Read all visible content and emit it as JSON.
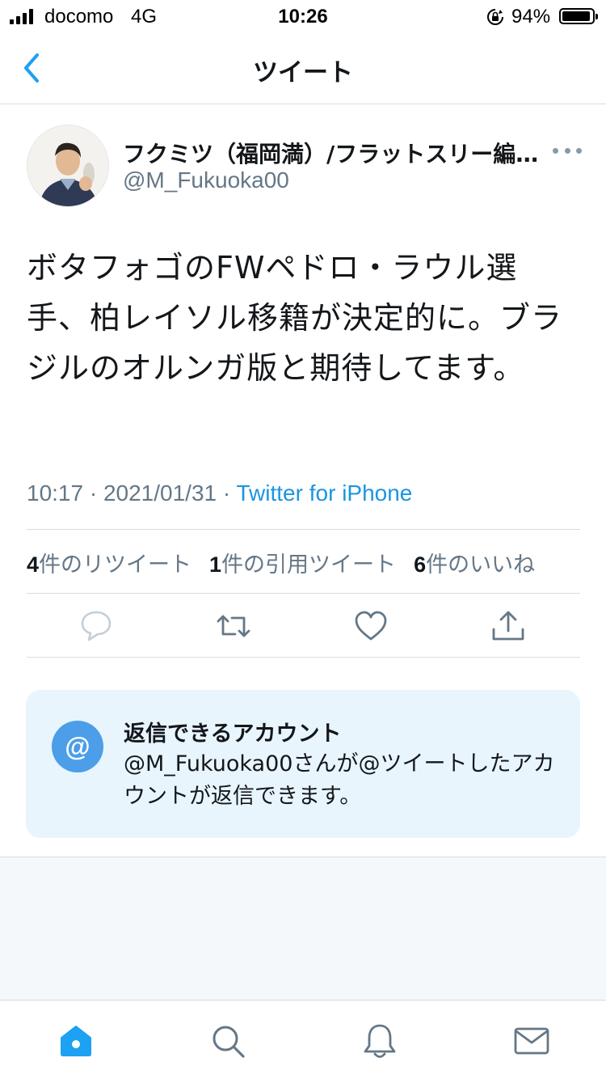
{
  "status_bar": {
    "carrier": "docomo",
    "network": "4G",
    "time": "10:26",
    "battery": "94%",
    "battery_level": 0.94
  },
  "nav": {
    "title": "ツイート",
    "back_icon": "chevron-left-icon"
  },
  "tweet": {
    "display_name": "フクミツ（福岡満）/フラットスリー編…",
    "username": "@M_Fukuoka00",
    "text": "ボタフォゴのFWペドロ・ラウル選手、柏レイソル移籍が決定的に。ブラジルのオルンガ版と期待してます。",
    "time": "10:17",
    "sep1": " · ",
    "date": "2021/01/31",
    "sep2": " · ",
    "source": "Twitter for iPhone"
  },
  "counts": {
    "retweets_num": "4",
    "retweets_label": "件のリツイート",
    "quotes_num": "1",
    "quotes_label": "件の引用ツイート",
    "likes_num": "6",
    "likes_label": "件のいいね"
  },
  "actions": [
    "reply-icon",
    "retweet-icon",
    "like-icon",
    "share-icon"
  ],
  "reply_card": {
    "icon_glyph": "@",
    "title": "返信できるアカウント",
    "description": "@M_Fukuoka00さんが@ツイートしたアカウントが返信できます。"
  },
  "tab_bar": [
    "home-icon",
    "search-icon",
    "notifications-icon",
    "messages-icon"
  ],
  "colors": {
    "accent": "#1da1f2",
    "link": "#1b95e0",
    "secondary_text": "#657786",
    "reply_card_bg": "#e8f5fd",
    "at_circle": "#4c9ee8"
  }
}
